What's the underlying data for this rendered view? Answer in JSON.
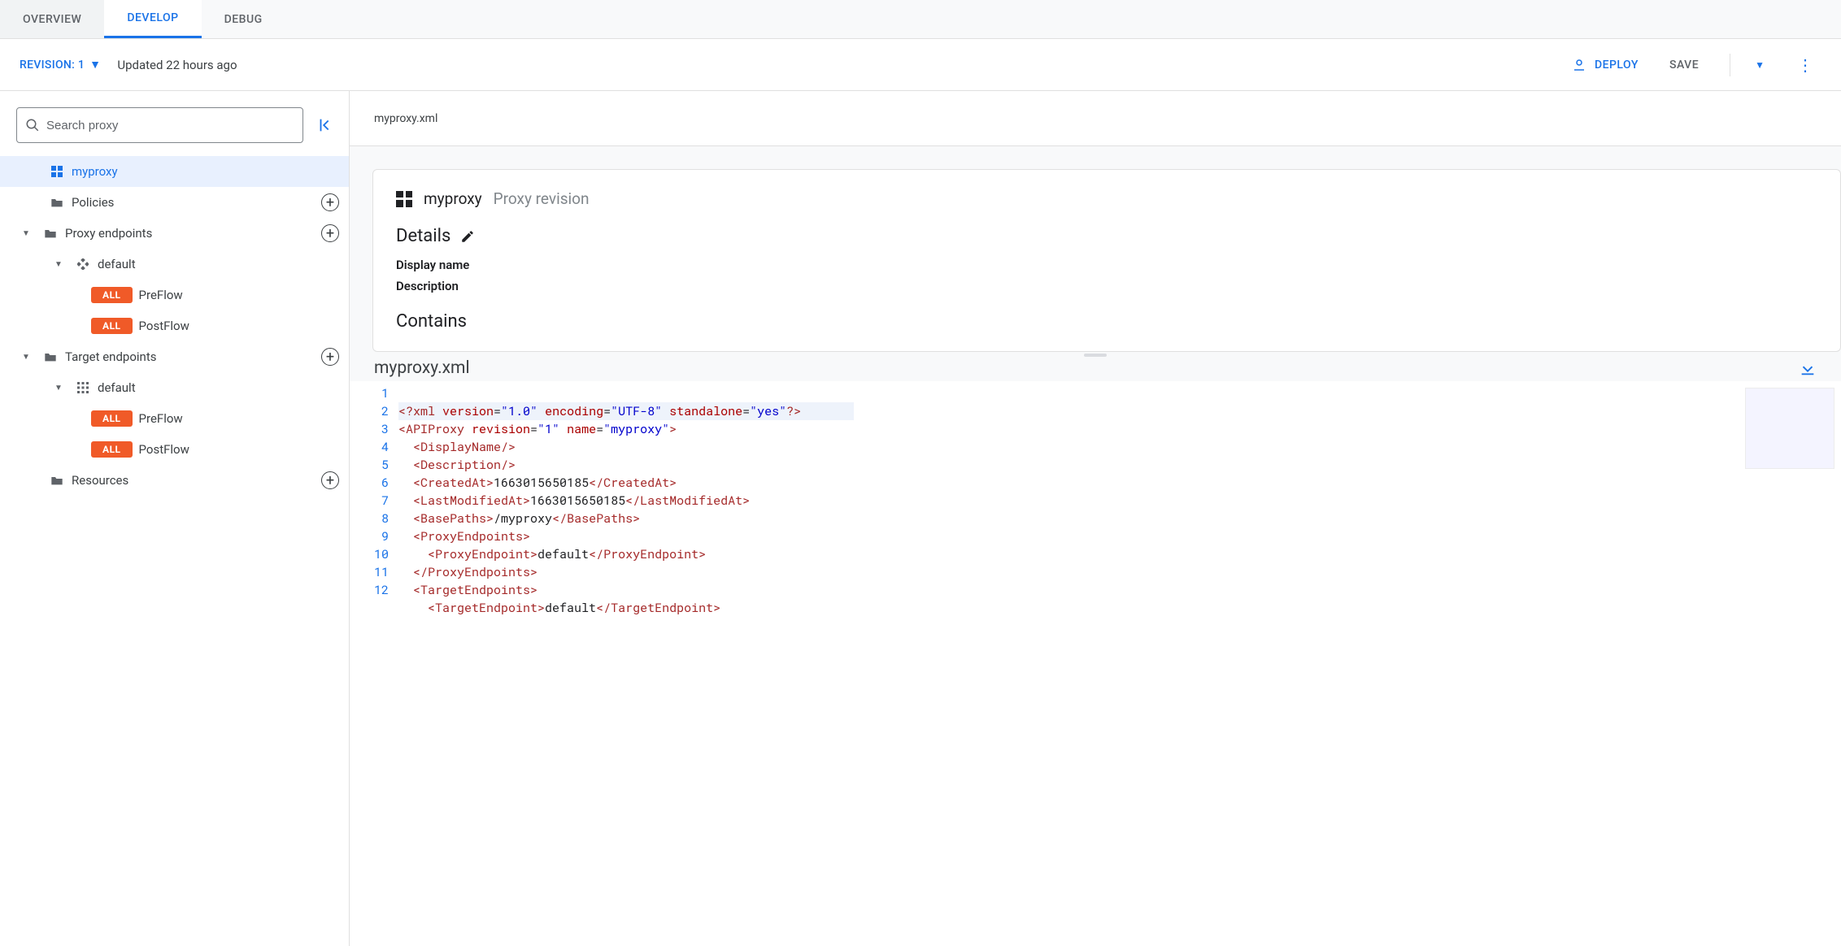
{
  "tabs": {
    "overview": "OVERVIEW",
    "develop": "DEVELOP",
    "debug": "DEBUG"
  },
  "sub": {
    "revision": "REVISION: 1",
    "updated": "Updated 22 hours ago",
    "deploy": "DEPLOY",
    "save": "SAVE"
  },
  "search": {
    "placeholder": "Search proxy"
  },
  "tree": {
    "root": "myproxy",
    "policies": "Policies",
    "proxy_endpoints": "Proxy endpoints",
    "pe_default": "default",
    "pe_preflow": "PreFlow",
    "pe_postflow": "PostFlow",
    "target_endpoints": "Target endpoints",
    "te_default": "default",
    "te_preflow": "PreFlow",
    "te_postflow": "PostFlow",
    "resources": "Resources",
    "badge": "ALL"
  },
  "main": {
    "header_file": "myproxy.xml",
    "proxy_name": "myproxy",
    "proxy_sub": "Proxy revision",
    "details": "Details",
    "display_name": "Display name",
    "description": "Description",
    "contains": "Contains"
  },
  "editor": {
    "title": "myproxy.xml"
  },
  "xml": {
    "l1": {
      "a": "<?xml ",
      "b": "version",
      "c": "=",
      "d": "\"1.0\"",
      "e": " encoding",
      "f": "=",
      "g": "\"UTF-8\"",
      "h": " standalone",
      "i": "=",
      "j": "\"yes\"",
      "k": "?>"
    },
    "l2": {
      "a": "<APIProxy ",
      "b": "revision",
      "c": "=",
      "d": "\"1\"",
      "e": " name",
      "f": "=",
      "g": "\"myproxy\"",
      "h": ">"
    },
    "l3": "<DisplayName/>",
    "l4": "<Description/>",
    "l5": {
      "a": "<CreatedAt>",
      "b": "1663015650185",
      "c": "</CreatedAt>"
    },
    "l6": {
      "a": "<LastModifiedAt>",
      "b": "1663015650185",
      "c": "</LastModifiedAt>"
    },
    "l7": {
      "a": "<BasePaths>",
      "b": "/myproxy",
      "c": "</BasePaths>"
    },
    "l8": "<ProxyEndpoints>",
    "l9": {
      "a": "<ProxyEndpoint>",
      "b": "default",
      "c": "</ProxyEndpoint>"
    },
    "l10": "</ProxyEndpoints>",
    "l11": "<TargetEndpoints>",
    "l12": {
      "a": "<TargetEndpoint>",
      "b": "default",
      "c": "</TargetEndpoint>"
    }
  }
}
